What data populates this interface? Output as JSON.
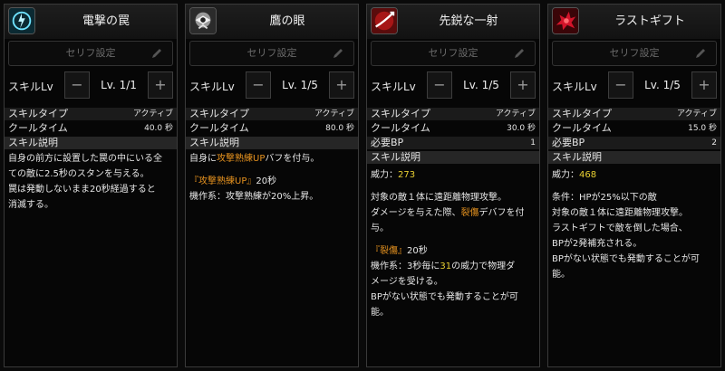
{
  "common": {
    "serif_label": "セリフ設定",
    "lv_label": "スキルLv",
    "minus": "−",
    "plus": "+",
    "skill_type_label": "スキルタイプ",
    "cooltime_label": "クールタイム",
    "bp_label": "必要BP",
    "desc_label": "スキル説明",
    "power_label": "威力："
  },
  "panels": [
    {
      "title": "電撃の罠",
      "level": "Lv. 1/1",
      "skill_type": "アクティブ",
      "cooltime": "40.0 秒",
      "desc": {
        "line1": "自身の前方に設置した罠の中にいる全",
        "line2": "ての敵に2.5秒のスタンを与える。",
        "line3": "罠は発動しないまま20秒経過すると",
        "line4": "消滅する。"
      }
    },
    {
      "title": "鷹の眼",
      "level": "Lv. 1/5",
      "skill_type": "アクティブ",
      "cooltime": "80.0 秒",
      "desc": {
        "l1a": "自身に",
        "l1b": "攻撃熟練UP",
        "l1c": "バフを付与。",
        "l2a": "『攻撃熟練UP』",
        "l2b": "20秒",
        "l3": "機作系：攻撃熟練が20%上昇。"
      }
    },
    {
      "title": "先鋭な一射",
      "level": "Lv. 1/5",
      "skill_type": "アクティブ",
      "cooltime": "30.0 秒",
      "bp": "1",
      "power": "273",
      "desc": {
        "l1": "対象の敵１体に遠距離物理攻撃。",
        "l2a": "ダメージを与えた際、",
        "l2b": "裂傷",
        "l2c": "デバフを付",
        "l3": "与。",
        "l4a": "『裂傷』",
        "l4b": "20秒",
        "l5a": "機作系：3秒毎に",
        "l5b": "31",
        "l5c": "の威力で物理ダ",
        "l6": "メージを受ける。",
        "l7": "BPがない状態でも発動することが可",
        "l8": "能。"
      }
    },
    {
      "title": "ラストギフト",
      "level": "Lv. 1/5",
      "skill_type": "アクティブ",
      "cooltime": "15.0 秒",
      "bp": "2",
      "power": "468",
      "desc": {
        "l1": "条件：HPが25%以下の敵",
        "l2": "対象の敵１体に遠距離物理攻撃。",
        "l3": "ラストギフトで敵を倒した場合、",
        "l4": "BPが2発補充される。",
        "l5": "BPがない状態でも発動することが可能。"
      }
    }
  ]
}
